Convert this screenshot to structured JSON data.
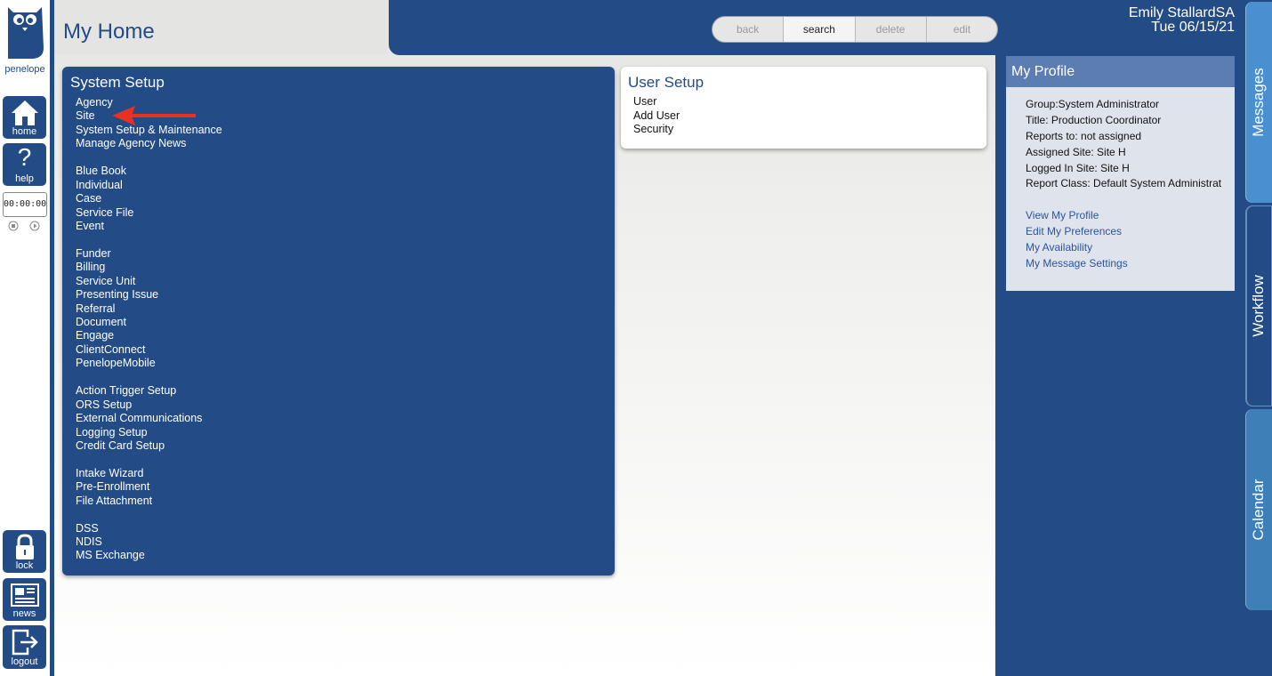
{
  "app": {
    "logo_text": "penelope"
  },
  "rail": {
    "home_label": "home",
    "help_label": "help",
    "timer_value": "00:00:00",
    "lock_label": "lock",
    "news_label": "news",
    "logout_label": "logout"
  },
  "page": {
    "title": "My Home"
  },
  "toolbar": {
    "back_label": "back",
    "search_label": "search",
    "delete_label": "delete",
    "edit_label": "edit"
  },
  "header": {
    "user_name": "Emily StallardSA",
    "date": "Tue 06/15/21"
  },
  "system_setup": {
    "title": "System Setup",
    "items": [
      "Agency",
      "Site",
      "System Setup & Maintenance",
      "Manage Agency News",
      "",
      "Blue Book",
      "Individual",
      "Case",
      "Service File",
      "Event",
      "",
      "Funder",
      "Billing",
      "Service Unit",
      "Presenting Issue",
      "Referral",
      "Document",
      "Engage",
      "ClientConnect",
      "PenelopeMobile",
      "",
      "Action Trigger Setup",
      "ORS Setup",
      "External Communications",
      "Logging Setup",
      "Credit Card Setup",
      "",
      "Intake Wizard",
      "Pre-Enrollment",
      "File Attachment",
      "",
      "DSS",
      "NDIS",
      "MS Exchange"
    ]
  },
  "user_setup": {
    "title": "User Setup",
    "items": [
      "User",
      "Add User",
      "Security"
    ]
  },
  "profile": {
    "title": "My Profile",
    "group": "Group:System Administrator",
    "job_title": "Title: Production Coordinator",
    "reports_to": "Reports to: not assigned",
    "assigned_site": "Assigned Site: Site H",
    "logged_in_site": "Logged In Site: Site H",
    "report_class": "Report Class: Default System Administrat",
    "links": [
      "View My Profile",
      "Edit My Preferences",
      "My Availability",
      "My Message Settings"
    ]
  },
  "side_tabs": {
    "messages": "Messages",
    "workflow": "Workflow",
    "calendar": "Calendar"
  },
  "colors": {
    "brand": "#234b86",
    "accent": "#4a8fd0",
    "annotation": "#e8321f"
  }
}
